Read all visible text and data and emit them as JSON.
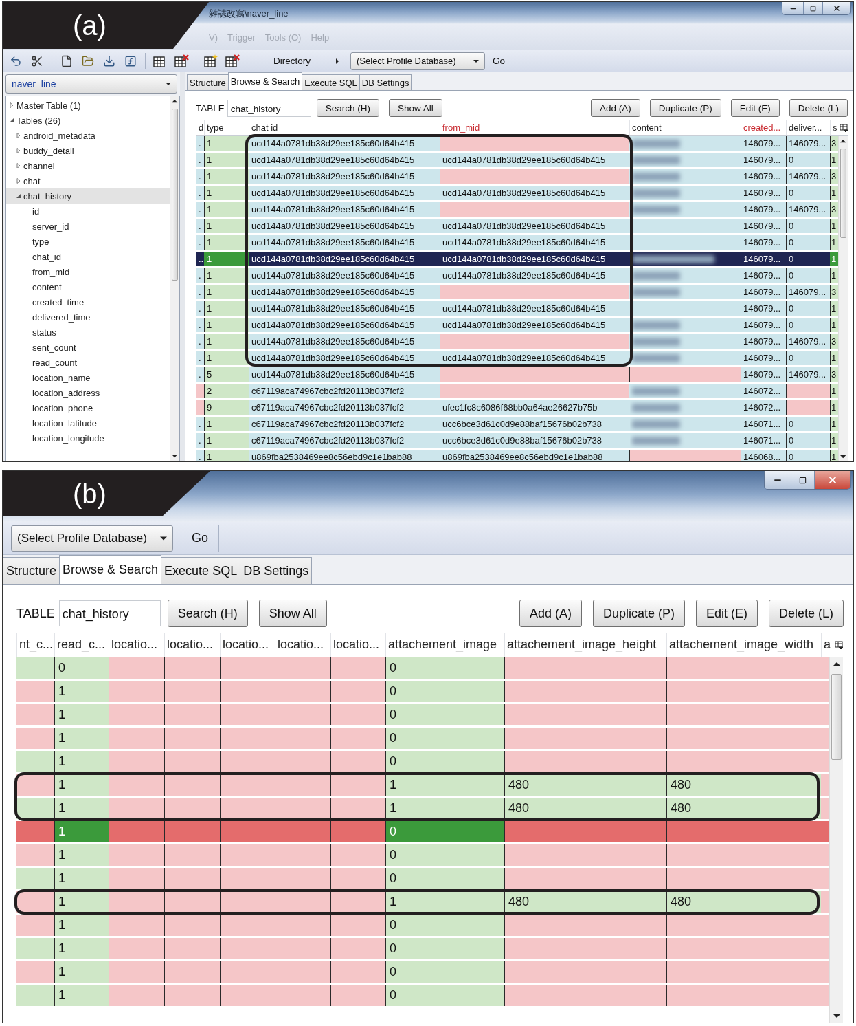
{
  "panel_a": {
    "label": "(a)",
    "window": {
      "title": "雜誌改寫\\naver_line"
    },
    "menu": [
      "V)",
      "Trigger",
      "Tools (O)",
      "Help"
    ],
    "toolbar": {
      "directory": "Directory",
      "profile_select": "(Select Profile Database)",
      "go": "Go"
    },
    "sidebar": {
      "database": "naver_line",
      "tree": [
        {
          "label": "Master Table (1)",
          "expanded": false,
          "selected": false
        },
        {
          "label": "Tables (26)",
          "expanded": true,
          "selected": false,
          "children": [
            {
              "label": "android_metadata",
              "expanded": false,
              "selected": false
            },
            {
              "label": "buddy_detail",
              "expanded": false,
              "selected": false
            },
            {
              "label": "channel",
              "expanded": false,
              "selected": false
            },
            {
              "label": "chat",
              "expanded": false,
              "selected": false
            },
            {
              "label": "chat_history",
              "expanded": true,
              "selected": true,
              "children": [
                {
                  "label": "id",
                  "selected": false
                },
                {
                  "label": "server_id",
                  "selected": false
                },
                {
                  "label": "type",
                  "selected": false
                },
                {
                  "label": "chat_id",
                  "selected": false
                },
                {
                  "label": "from_mid",
                  "selected": false
                },
                {
                  "label": "content",
                  "selected": false
                },
                {
                  "label": "created_time",
                  "selected": false
                },
                {
                  "label": "delivered_time",
                  "selected": false
                },
                {
                  "label": "status",
                  "selected": false
                },
                {
                  "label": "sent_count",
                  "selected": false
                },
                {
                  "label": "read_count",
                  "selected": false
                },
                {
                  "label": "location_name",
                  "selected": false
                },
                {
                  "label": "location_address",
                  "selected": false
                },
                {
                  "label": "location_phone",
                  "selected": false
                },
                {
                  "label": "location_latitude",
                  "selected": false
                },
                {
                  "label": "location_longitude",
                  "selected": false
                }
              ]
            }
          ]
        }
      ]
    },
    "tabs": [
      {
        "label": "Structure",
        "selected": false
      },
      {
        "label": "Browse & Search",
        "selected": true
      },
      {
        "label": "Execute SQL",
        "selected": false
      },
      {
        "label": "DB Settings",
        "selected": false
      }
    ],
    "table_label": "TABLE",
    "table_name": "chat_history",
    "buttons_left": [
      "Search (H)",
      "Show All"
    ],
    "buttons_right": [
      "Add (A)",
      "Duplicate (P)",
      "Edit (E)",
      "Delete (L)"
    ],
    "columns": [
      {
        "label": "d",
        "highlighted": false
      },
      {
        "label": "type",
        "highlighted": false
      },
      {
        "label": "chat id",
        "highlighted": false
      },
      {
        "label": "from_mid",
        "highlighted": true
      },
      {
        "label": "content",
        "highlighted": false
      },
      {
        "label": "created...",
        "highlighted": true
      },
      {
        "label": "deliver...",
        "highlighted": false
      },
      {
        "label": "s",
        "highlighted": false
      }
    ],
    "rows": [
      {
        "cells": [
          ".",
          "1",
          "ucd144a0781db38d29ee185c60d64b415",
          null,
          {
            "redacted": true
          },
          "146079...",
          "146079...",
          "3"
        ],
        "selected": false,
        "highlighted": true
      },
      {
        "cells": [
          ".",
          "1",
          "ucd144a0781db38d29ee185c60d64b415",
          "ucd144a0781db38d29ee185c60d64b415",
          {
            "redacted": true
          },
          "146079...",
          "0",
          "1"
        ],
        "selected": false,
        "highlighted": true
      },
      {
        "cells": [
          ".",
          "1",
          "ucd144a0781db38d29ee185c60d64b415",
          null,
          {
            "redacted": true
          },
          "146079...",
          "146079...",
          "3"
        ],
        "selected": false,
        "highlighted": true
      },
      {
        "cells": [
          ".",
          "1",
          "ucd144a0781db38d29ee185c60d64b415",
          "ucd144a0781db38d29ee185c60d64b415",
          {
            "redacted": true
          },
          "146079...",
          "0",
          "1"
        ],
        "selected": false,
        "highlighted": true
      },
      {
        "cells": [
          ".",
          "1",
          "ucd144a0781db38d29ee185c60d64b415",
          null,
          {
            "redacted": true
          },
          "146079...",
          "146079...",
          "3"
        ],
        "selected": false,
        "highlighted": true
      },
      {
        "cells": [
          ".",
          "1",
          "ucd144a0781db38d29ee185c60d64b415",
          "ucd144a0781db38d29ee185c60d64b415",
          {
            "redacted": false
          },
          "146079...",
          "0",
          "1"
        ],
        "selected": false,
        "highlighted": true
      },
      {
        "cells": [
          ".",
          "1",
          "ucd144a0781db38d29ee185c60d64b415",
          "ucd144a0781db38d29ee185c60d64b415",
          {
            "redacted": false
          },
          "146079...",
          "0",
          "1"
        ],
        "selected": false,
        "highlighted": true
      },
      {
        "cells": [
          "..",
          "1",
          "ucd144a0781db38d29ee185c60d64b415",
          "ucd144a0781db38d29ee185c60d64b415",
          {
            "redacted": true
          },
          "146079...",
          "0",
          "1"
        ],
        "selected": true,
        "highlighted": true
      },
      {
        "cells": [
          ".",
          "1",
          "ucd144a0781db38d29ee185c60d64b415",
          "ucd144a0781db38d29ee185c60d64b415",
          {
            "redacted": true
          },
          "146079...",
          "0",
          "1"
        ],
        "selected": false,
        "highlighted": true
      },
      {
        "cells": [
          ".",
          "1",
          "ucd144a0781db38d29ee185c60d64b415",
          null,
          {
            "redacted": true
          },
          "146079...",
          "146079...",
          "3"
        ],
        "selected": false,
        "highlighted": true
      },
      {
        "cells": [
          ".",
          "1",
          "ucd144a0781db38d29ee185c60d64b415",
          "ucd144a0781db38d29ee185c60d64b415",
          {
            "redacted": false
          },
          "146079...",
          "0",
          "1"
        ],
        "selected": false,
        "highlighted": true
      },
      {
        "cells": [
          ".",
          "1",
          "ucd144a0781db38d29ee185c60d64b415",
          "ucd144a0781db38d29ee185c60d64b415",
          {
            "redacted": true
          },
          "146079...",
          "0",
          "1"
        ],
        "selected": false,
        "highlighted": true
      },
      {
        "cells": [
          ".",
          "1",
          "ucd144a0781db38d29ee185c60d64b415",
          null,
          {
            "redacted": true
          },
          "146079...",
          "146079...",
          "3"
        ],
        "selected": false,
        "highlighted": true
      },
      {
        "cells": [
          ".",
          "1",
          "ucd144a0781db38d29ee185c60d64b415",
          "ucd144a0781db38d29ee185c60d64b415",
          {
            "redacted": true
          },
          "146079...",
          "0",
          "1"
        ],
        "selected": false,
        "highlighted": true
      },
      {
        "cells": [
          ".",
          "5",
          "ucd144a0781db38d29ee185c60d64b415",
          null,
          null,
          "146079...",
          "146079...",
          "3"
        ],
        "selected": false,
        "highlighted": false
      },
      {
        "cells": [
          null,
          "2",
          "c67119aca74967cbc2fd20113b037fcf2",
          null,
          {
            "redacted": true
          },
          "146072...",
          null,
          "1"
        ],
        "selected": false,
        "highlighted": false
      },
      {
        "cells": [
          null,
          "9",
          "c67119aca74967cbc2fd20113b037fcf2",
          "ufec1fc8c6086f68bb0a64ae26627b75b",
          {
            "redacted": true
          },
          "146072...",
          null,
          "1"
        ],
        "selected": false,
        "highlighted": false
      },
      {
        "cells": [
          ".",
          "1",
          "c67119aca74967cbc2fd20113b037fcf2",
          "ucc6bce3d61c0d9e88baf15676b02b738",
          {
            "redacted": true
          },
          "146071...",
          "0",
          "1"
        ],
        "selected": false,
        "highlighted": false
      },
      {
        "cells": [
          ".",
          "1",
          "c67119aca74967cbc2fd20113b037fcf2",
          "ucc6bce3d61c0d9e88baf15676b02b738",
          {
            "redacted": true
          },
          "146071...",
          "0",
          "1"
        ],
        "selected": false,
        "highlighted": false
      },
      {
        "cells": [
          ".",
          "1",
          "u869fba2538469ee8c56ebd9c1e1bab88",
          "u869fba2538469ee8c56ebd9c1e1bab88",
          null,
          "146068...",
          "0",
          "1"
        ],
        "selected": false,
        "highlighted": false
      }
    ]
  },
  "panel_b": {
    "label": "(b)",
    "toolbar": {
      "profile_select": "(Select Profile Database)",
      "go": "Go"
    },
    "tabs": [
      {
        "label": "Structure",
        "selected": false
      },
      {
        "label": "Browse & Search",
        "selected": true
      },
      {
        "label": "Execute SQL",
        "selected": false
      },
      {
        "label": "DB Settings",
        "selected": false
      }
    ],
    "table_label": "TABLE",
    "table_name": "chat_history",
    "buttons_left": [
      "Search (H)",
      "Show All"
    ],
    "buttons_right": [
      "Add (A)",
      "Duplicate (P)",
      "Edit (E)",
      "Delete (L)"
    ],
    "columns": [
      "nt_c...",
      "read_c...",
      "locatio...",
      "locatio...",
      "locatio...",
      "locatio...",
      "locatio...",
      "attachement_image",
      "attachement_image_height",
      "attachement_image_width",
      "a"
    ],
    "rows": [
      {
        "cells": [
          {
            "filled": true
          },
          "0",
          null,
          null,
          null,
          null,
          null,
          "0",
          null,
          null,
          null
        ],
        "selected": false,
        "highlighted": false
      },
      {
        "cells": [
          {
            "filled": false
          },
          "1",
          null,
          null,
          null,
          null,
          null,
          "0",
          null,
          null,
          null
        ],
        "selected": false,
        "highlighted": false
      },
      {
        "cells": [
          {
            "filled": false
          },
          "1",
          null,
          null,
          null,
          null,
          null,
          "0",
          null,
          null,
          null
        ],
        "selected": false,
        "highlighted": false
      },
      {
        "cells": [
          {
            "filled": false
          },
          "1",
          null,
          null,
          null,
          null,
          null,
          "0",
          null,
          null,
          null
        ],
        "selected": false,
        "highlighted": false
      },
      {
        "cells": [
          {
            "filled": true
          },
          "1",
          null,
          null,
          null,
          null,
          null,
          "0",
          null,
          null,
          null
        ],
        "selected": false,
        "highlighted": false
      },
      {
        "cells": [
          {
            "filled": false
          },
          "1",
          null,
          null,
          null,
          null,
          null,
          "1",
          "480",
          "480",
          null
        ],
        "selected": false,
        "highlighted": true
      },
      {
        "cells": [
          {
            "filled": true
          },
          "1",
          null,
          null,
          null,
          null,
          null,
          "1",
          "480",
          "480",
          null
        ],
        "selected": false,
        "highlighted": true
      },
      {
        "cells": [
          {
            "filled": false
          },
          "1",
          null,
          null,
          null,
          null,
          null,
          "0",
          null,
          null,
          null
        ],
        "selected": true,
        "highlighted": false
      },
      {
        "cells": [
          {
            "filled": false
          },
          "1",
          null,
          null,
          null,
          null,
          null,
          "0",
          null,
          null,
          null
        ],
        "selected": false,
        "highlighted": false
      },
      {
        "cells": [
          {
            "filled": true
          },
          "1",
          null,
          null,
          null,
          null,
          null,
          "0",
          null,
          null,
          null
        ],
        "selected": false,
        "highlighted": false
      },
      {
        "cells": [
          {
            "filled": false
          },
          "1",
          null,
          null,
          null,
          null,
          null,
          "1",
          "480",
          "480",
          null
        ],
        "selected": false,
        "highlighted": true
      },
      {
        "cells": [
          {
            "filled": false
          },
          "1",
          null,
          null,
          null,
          null,
          null,
          "0",
          null,
          null,
          null
        ],
        "selected": false,
        "highlighted": false
      },
      {
        "cells": [
          {
            "filled": true
          },
          "1",
          null,
          null,
          null,
          null,
          null,
          "0",
          null,
          null,
          null
        ],
        "selected": false,
        "highlighted": false
      },
      {
        "cells": [
          {
            "filled": false
          },
          "1",
          null,
          null,
          null,
          null,
          null,
          "0",
          null,
          null,
          null
        ],
        "selected": false,
        "highlighted": false
      },
      {
        "cells": [
          {
            "filled": true
          },
          "1",
          null,
          null,
          null,
          null,
          null,
          "0",
          null,
          null,
          null
        ],
        "selected": false,
        "highlighted": false
      }
    ]
  }
}
